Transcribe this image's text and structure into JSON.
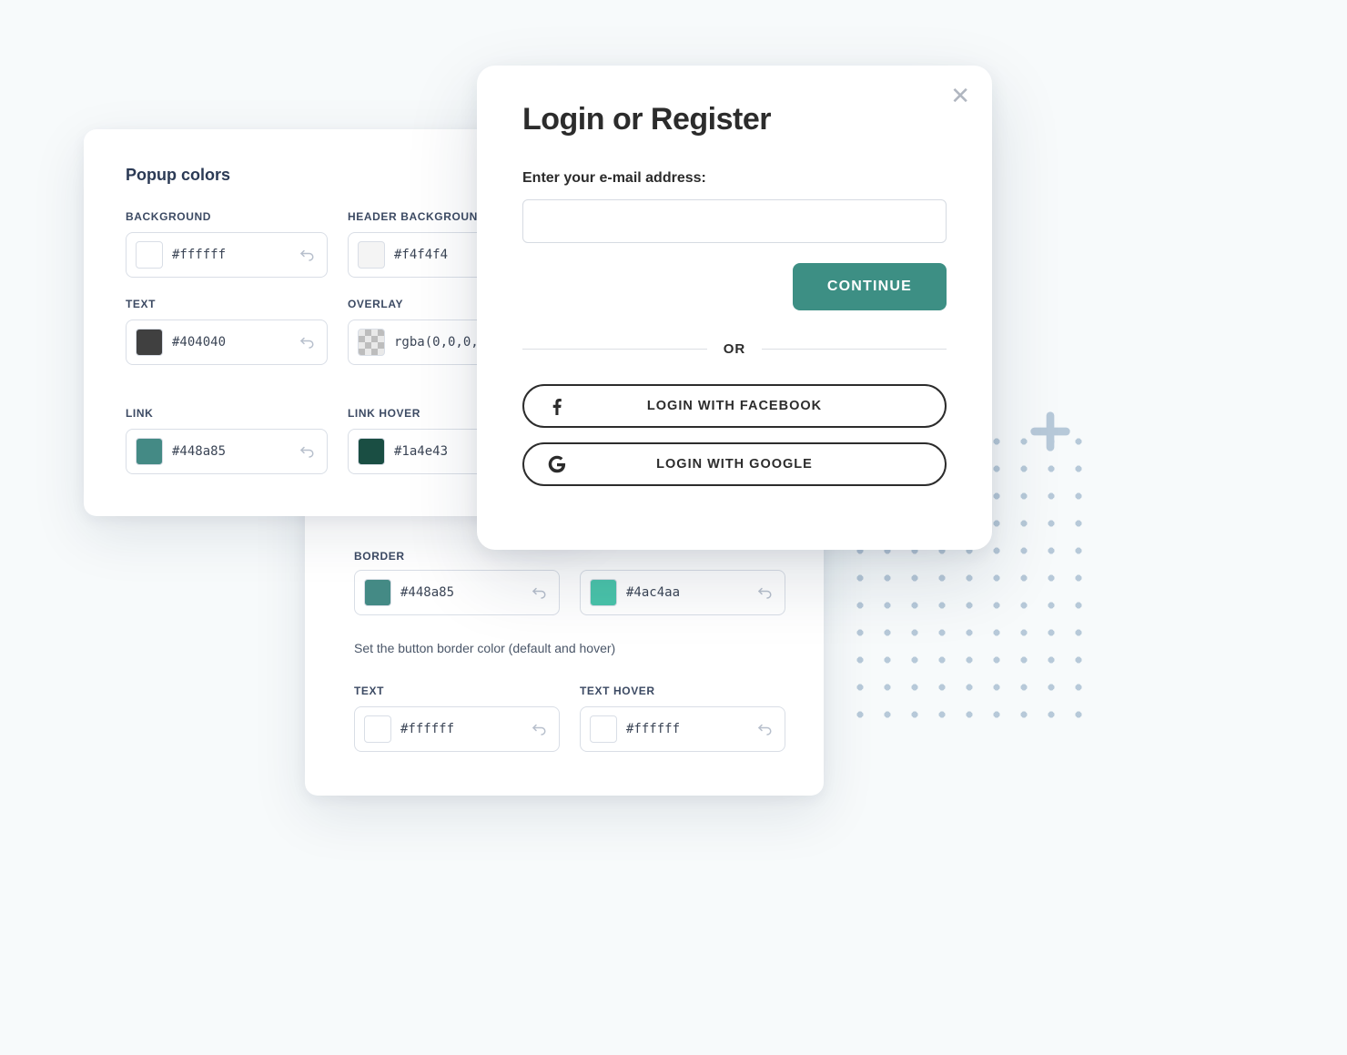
{
  "popup_colors": {
    "title": "Popup colors",
    "fields": {
      "background": {
        "label": "BACKGROUND",
        "value": "#ffffff",
        "swatch": "#ffffff"
      },
      "header_background": {
        "label": "HEADER BACKGROUND",
        "value": "#f4f4f4",
        "swatch": "#f4f4f4"
      },
      "text": {
        "label": "TEXT",
        "value": "#404040",
        "swatch": "#404040"
      },
      "overlay": {
        "label": "OVERLAY",
        "value": "rgba(0,0,0,",
        "swatch": "checker"
      },
      "link": {
        "label": "LINK",
        "value": "#448a85",
        "swatch": "#448a85"
      },
      "link_hover": {
        "label": "LINK HOVER",
        "value": "#1a4e43",
        "swatch": "#1a4e43"
      }
    }
  },
  "button_colors": {
    "border_label": "BORDER",
    "border_default": {
      "value": "#448a85",
      "swatch": "#448a85"
    },
    "border_hover": {
      "value": "#4ac4aa",
      "swatch": "#4ac4aa"
    },
    "border_hint": "Set the button border color (default and hover)",
    "text_label": "TEXT",
    "text_hover_label": "TEXT HOVER",
    "text_default": {
      "value": "#ffffff",
      "swatch": "#ffffff"
    },
    "text_hover": {
      "value": "#ffffff",
      "swatch": "#ffffff"
    }
  },
  "login": {
    "title": "Login or Register",
    "subtitle": "Enter your e-mail address:",
    "email_value": "",
    "continue": "CONTINUE",
    "or": "OR",
    "facebook": "LOGIN WITH FACEBOOK",
    "google": "LOGIN WITH GOOGLE"
  }
}
